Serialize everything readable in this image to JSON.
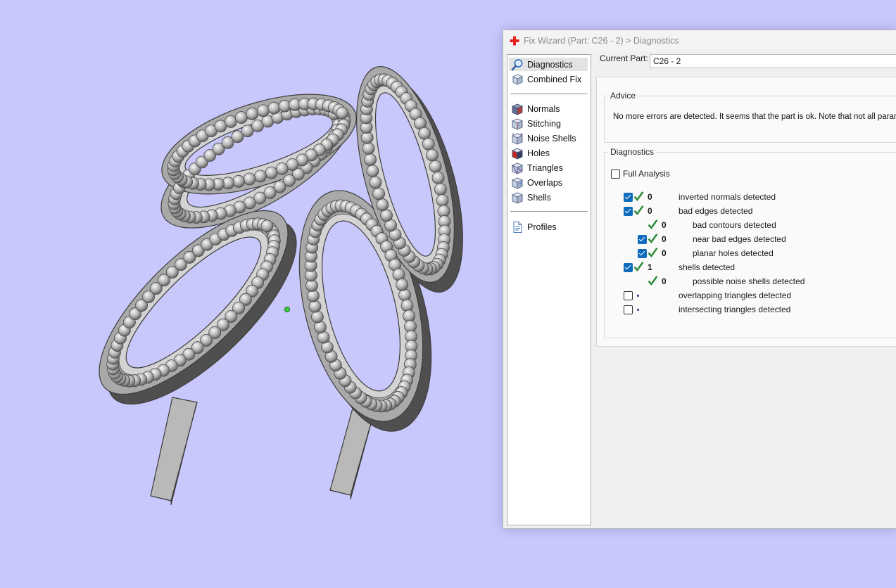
{
  "window": {
    "title": "Fix Wizard (Part: C26 - 2) > Diagnostics"
  },
  "nav": {
    "items": [
      {
        "label": "Diagnostics",
        "icon": "magnifier-icon",
        "selected": true
      },
      {
        "label": "Combined Fix",
        "icon": "cube-icon"
      },
      {
        "label": "Normals",
        "icon": "normals-cube-icon"
      },
      {
        "label": "Stitching",
        "icon": "stitching-cube-icon"
      },
      {
        "label": "Noise Shells",
        "icon": "noise-shells-icon"
      },
      {
        "label": "Holes",
        "icon": "holes-cube-icon"
      },
      {
        "label": "Triangles",
        "icon": "triangles-cube-icon"
      },
      {
        "label": "Overlaps",
        "icon": "overlaps-cube-icon"
      },
      {
        "label": "Shells",
        "icon": "shells-cube-icon"
      },
      {
        "label": "Profiles",
        "icon": "document-icon"
      }
    ]
  },
  "current_part": {
    "label": "Current Part:",
    "value": "C26 - 2"
  },
  "advice": {
    "title": "Advice",
    "text": "No more errors are detected. It seems that the part is ok. Note that not all paramete"
  },
  "diagnostics": {
    "title": "Diagnostics",
    "full_analysis": {
      "label": "Full Analysis",
      "checked": false
    },
    "rows": [
      {
        "checked": true,
        "status": "ok",
        "count": "0",
        "label": "inverted normals detected"
      },
      {
        "checked": true,
        "status": "ok",
        "count": "0",
        "label": "bad edges detected"
      },
      {
        "checkbox": false,
        "status": "ok",
        "count": "0",
        "label": "bad contours detected"
      },
      {
        "checked": true,
        "status": "ok",
        "count": "0",
        "label": "near bad edges detected"
      },
      {
        "checked": true,
        "status": "ok",
        "count": "0",
        "label": "planar holes detected"
      },
      {
        "checked": true,
        "status": "ok",
        "count": "1",
        "label": "shells detected"
      },
      {
        "checkbox": false,
        "status": "ok",
        "count": "0",
        "label": "possible noise shells detected"
      },
      {
        "checked": false,
        "status": "pending",
        "count": "",
        "label": "overlapping triangles detected"
      },
      {
        "checked": false,
        "status": "pending",
        "count": "",
        "label": "intersecting triangles detected"
      }
    ]
  },
  "colors": {
    "viewport_background": "#c8c8fc",
    "checkbox_accent": "#0f6cbd",
    "ok_tick": "#2e8b3a",
    "part_metal": "#a9a9a9"
  }
}
